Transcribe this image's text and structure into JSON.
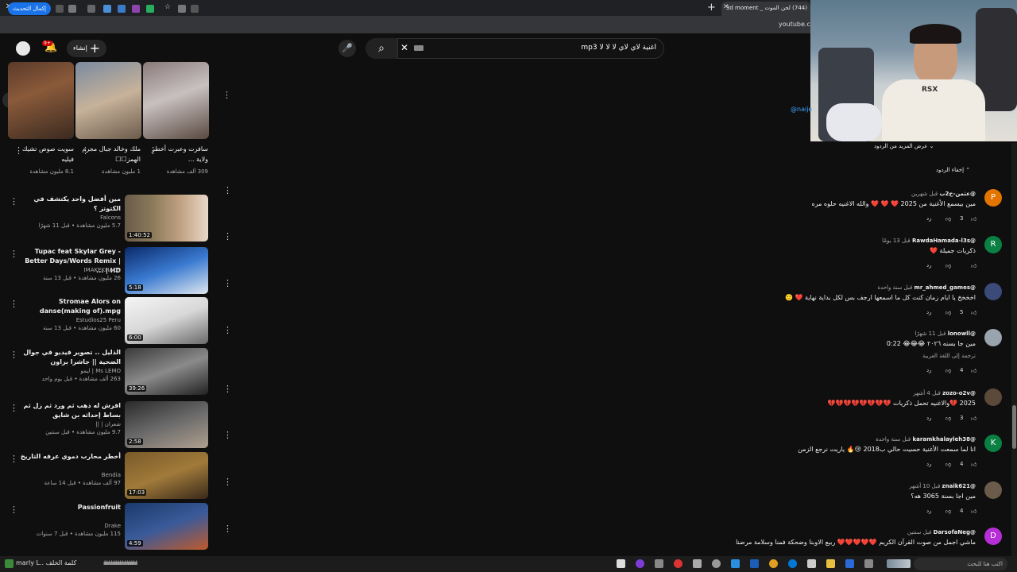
{
  "browser": {
    "tab_title": "(744) لحن الموت _ 3d moment",
    "url": "youtube.com",
    "update_label": "إكمال التحديث"
  },
  "header": {
    "create_label": "إنشاء",
    "notif_count": "9+",
    "search_query": "اغنية لاي لاي لا لا لا mp3"
  },
  "channel_handle": "@naije",
  "shorts": [
    {
      "title": "سافرت وعبرت أخطر ولاية ...",
      "views": "309 ألف مشاهدة"
    },
    {
      "title": "ملك وخالد جبال مجرم الهمز☐☐",
      "views": "1 مليون مشاهدة"
    },
    {
      "title": "سويت صوص تشيك فيليه",
      "views": "8.1 مليون مشاهدة"
    }
  ],
  "videos": [
    {
      "title": "مين أفضل واحد يكتشف في الكتوتز ؟",
      "channel": "Falcons",
      "meta": "5.7 مليون مشاهدة • قبل 11 شهرًا",
      "duration": "1:40:52"
    },
    {
      "title": "Tupac feat Skylar Grey - Better Days/Words Remix | HD | ...",
      "channel": "IMAKEKHAOS",
      "meta": "26 مليون مشاهدة • قبل 13 سنة",
      "duration": "5:18"
    },
    {
      "title": "Stromae   Alors on danse(making of).mpg",
      "channel": "Estudios25 Peru",
      "meta": "60 مليون مشاهدة • قبل 13 سنة",
      "duration": "6:00"
    },
    {
      "title": "الذليل .. تصوير فيديو في جوال الضحية || جاشرا براون",
      "channel": "Ms LEMO | ليمو",
      "meta": "263 ألف مشاهدة • قبل يوم واحد",
      "duration": "39:26"
    },
    {
      "title": "افرش له ذهب ثم ورد ثم زل ثم بساط إحداثه بن شايق",
      "channel": "شعران | ||",
      "meta": "9.7 مليون مشاهدة • قبل سنتين",
      "duration": "2:58"
    },
    {
      "title": "أخطر محارب دموي عرفه التاريخ",
      "channel": "Bendia",
      "meta": "97 ألف مشاهدة • قبل 14 ساعة",
      "duration": "17:03"
    },
    {
      "title": "Passionfruit",
      "channel": "Drake",
      "meta": "115 مليون مشاهدة • قبل 7 سنوات",
      "duration": "4:59"
    }
  ],
  "comments_ui": {
    "more_replies": "عرض المزيد من الردود",
    "hide_replies": "إخفاء الردود",
    "reply_label": "رد",
    "translate_label": "ترجمة إلى اللغة العربية"
  },
  "comments": [
    {
      "author": "@عثمن-ح2ب",
      "time": "قبل شهرين",
      "text": "مين بيسمع الأغنية من 2025 ❤️ ❤️ ❤️ والله الاغنيه حلوه مره",
      "likes": "3",
      "avatar_letter": "P",
      "avatar_color": "#e37400"
    },
    {
      "author": "@RawdaHamada-l3s",
      "time": "قبل 13 يومًا",
      "text": "ذكريات جميلة ❤️",
      "likes": "",
      "avatar_letter": "R",
      "avatar_color": "#0b8043"
    },
    {
      "author": "@mr_ahmed_games",
      "time": "قبل سنة واحدة",
      "text": "اخخخخ يا ايام زمان كنت كل ما اسمعها ارجف بس لكل بداية نهاية ❤️ 🙂",
      "likes": "5",
      "avatar_letter": "",
      "avatar_color": "#3c4a7a"
    },
    {
      "author": "@lonowll",
      "time": "قبل 11 شهرًا",
      "text": "مين جا بسنه ٢٠٢٦ 😂😂😂 0:22",
      "likes": "4",
      "avatar_letter": "",
      "avatar_color": "#9aa4ae"
    },
    {
      "author": "@zozo-o2v",
      "time": "قبل 4 أشهر",
      "text": "2025 💔والاغنيه تحمل ذكريات 💔💔💔💔💔💔💔💔",
      "likes": "3",
      "avatar_letter": "",
      "avatar_color": "#5b4a3a"
    },
    {
      "author": "@karamkhalayleh38",
      "time": "قبل سنة واحدة",
      "text": "انا لما سمعت الأغنية حسيت حالي ب2018 😢🔥 ياريت نرجع الزمن",
      "likes": "4",
      "avatar_letter": "K",
      "avatar_color": "#0b8043"
    },
    {
      "author": "@znaik621",
      "time": "قبل 10 أشهر",
      "text": "مين اجا بسنة 3065 هه؟",
      "likes": "4",
      "avatar_letter": "",
      "avatar_color": "#6b5b4b"
    },
    {
      "author": "@DarsofaNeg",
      "time": "قبل سنتين",
      "text": "ماشي اجمل من صوت القرآن الكريم ❤️❤️❤️❤️❤️ ربيع الاوبنا وضحكة فمنا وسلامة مرضنا",
      "likes": "",
      "avatar_letter": "D",
      "avatar_color": "#b52ed6"
    }
  ],
  "taskbar": {
    "media_text": "marly L.. كلمة الخلف",
    "search_placeholder": "اكتب هنا للبحث"
  }
}
